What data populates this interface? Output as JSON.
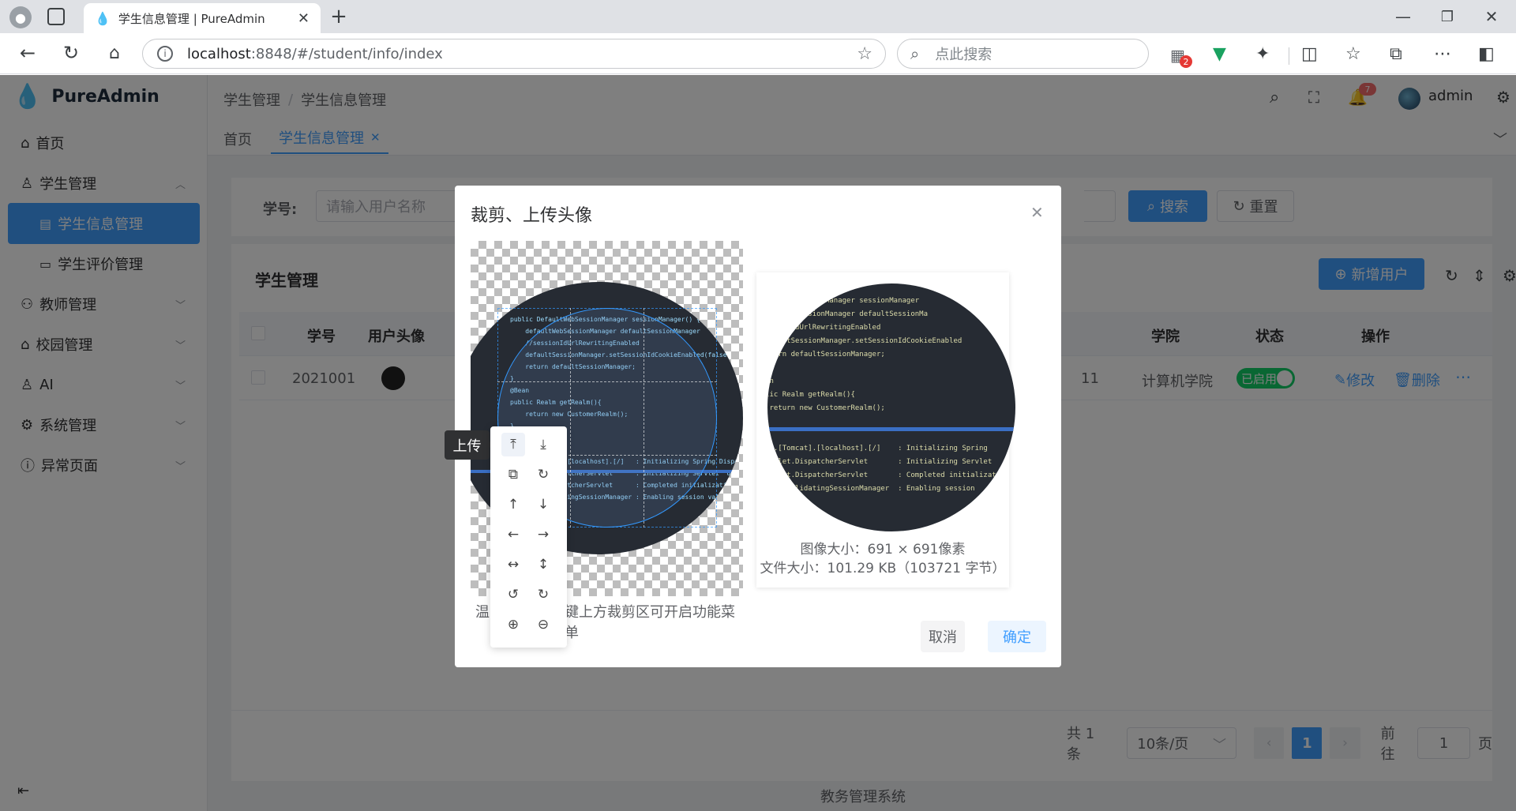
{
  "browser": {
    "tab_title": "学生信息管理 | PureAdmin",
    "url_host": "localhost",
    "url_rest": ":8848/#/student/info/index",
    "search_placeholder": "点此搜索",
    "ext_badge": "2"
  },
  "app": {
    "logo_text": "PureAdmin",
    "menu": [
      {
        "label": "首页",
        "icon": "home-icon"
      },
      {
        "label": "学生管理",
        "icon": "user-icon"
      },
      {
        "label": "学生信息管理",
        "icon": "idcard-icon"
      },
      {
        "label": "学生评价管理",
        "icon": "comment-icon"
      },
      {
        "label": "教师管理",
        "icon": "group-icon"
      },
      {
        "label": "校园管理",
        "icon": "building-icon"
      },
      {
        "label": "AI",
        "icon": "user-icon"
      },
      {
        "label": "系统管理",
        "icon": "gear-icon"
      },
      {
        "label": "异常页面",
        "icon": "info-icon"
      }
    ],
    "breadcrumb": [
      "学生管理",
      "学生信息管理"
    ],
    "user": "admin",
    "notif_count": "7",
    "tags": [
      "首页",
      "学生信息管理"
    ],
    "footer": "教务管理系统"
  },
  "search_form": {
    "label": "学号:",
    "placeholder": "请输入用户名称",
    "search_btn": "搜索",
    "reset_btn": "重置"
  },
  "table": {
    "title": "学生管理",
    "add_btn": "新增用户",
    "headers": [
      "学号",
      "用户头像",
      "学院",
      "状态",
      "操作"
    ],
    "row": {
      "id": "2021001",
      "partial_cell": "11",
      "college": "计算机学院",
      "status": "已启用",
      "edit": "修改",
      "delete": "删除"
    }
  },
  "pagination": {
    "total": "共 1 条",
    "page_size": "10条/页",
    "current": "1",
    "goto_label": "前往",
    "goto_value": "1",
    "page_suffix": "页"
  },
  "dialog": {
    "title": "裁剪、上传头像",
    "tip_start": "温",
    "tip_end": "键上方裁剪区可开启功能菜单",
    "tooltip": "上传",
    "image_size": "图像大小：691 × 691像素",
    "file_size": "文件大小：101.29 KB（103721 字节）",
    "cancel": "取消",
    "confirm": "确定"
  },
  "colors": {
    "primary": "#409eff",
    "active_menu": "#409eff",
    "status_on": "#13ce66"
  }
}
